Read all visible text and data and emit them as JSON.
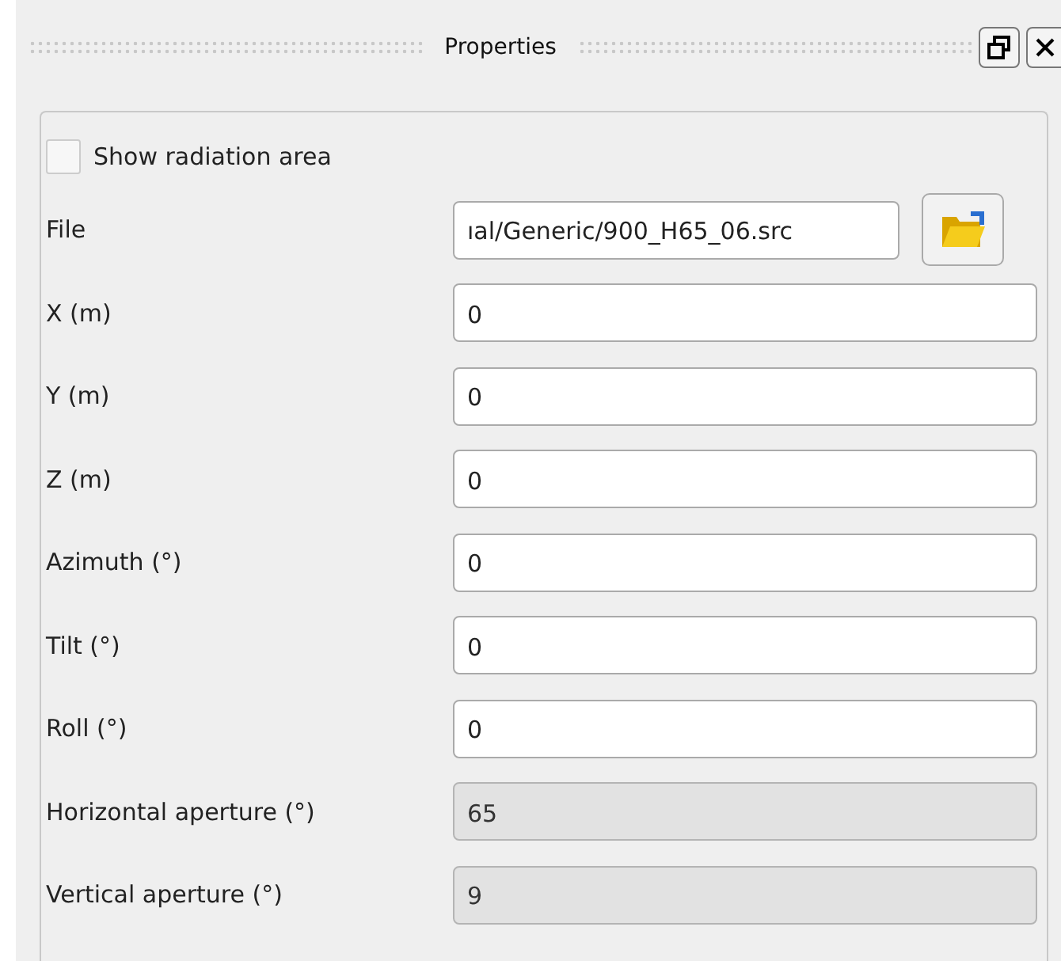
{
  "panel": {
    "title": "Properties"
  },
  "checkbox": {
    "label": "Show radiation area",
    "checked": false
  },
  "fields": [
    {
      "kind": "file",
      "label": "File",
      "value": "ıal/Generic/900_H65_06.src",
      "disabled": false
    },
    {
      "kind": "text",
      "label": "X (m)",
      "value": "0",
      "disabled": false
    },
    {
      "kind": "text",
      "label": "Y (m)",
      "value": "0",
      "disabled": false
    },
    {
      "kind": "text",
      "label": "Z (m)",
      "value": "0",
      "disabled": false
    },
    {
      "kind": "text",
      "label": "Azimuth (°)",
      "value": "0",
      "disabled": false
    },
    {
      "kind": "text",
      "label": "Tilt (°)",
      "value": "0",
      "disabled": false
    },
    {
      "kind": "text",
      "label": "Roll (°)",
      "value": "0",
      "disabled": false
    },
    {
      "kind": "text",
      "label": "Horizontal aperture (°)",
      "value": "65",
      "disabled": true
    },
    {
      "kind": "text",
      "label": "Vertical aperture (°)",
      "value": "9",
      "disabled": true
    }
  ]
}
